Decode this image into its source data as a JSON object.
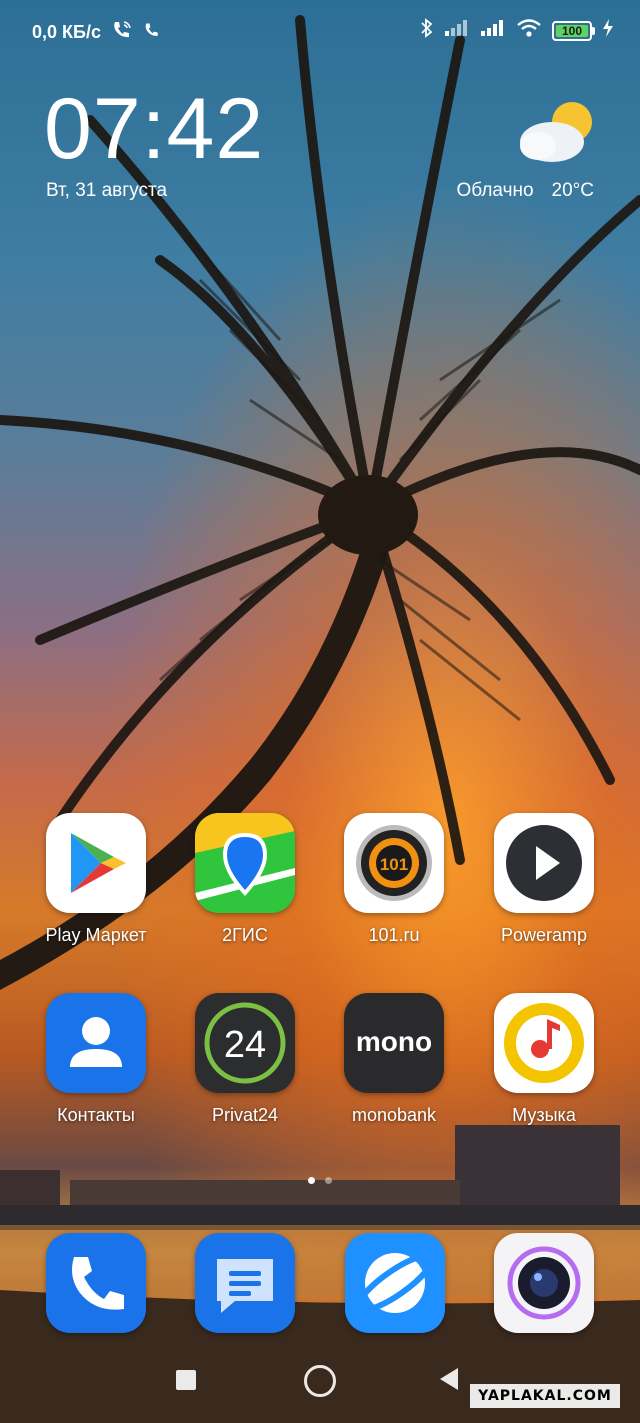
{
  "status_bar": {
    "network_speed": "0,0 КБ/с",
    "battery_level": "100",
    "icons": [
      "wifi-calling-icon",
      "call-icon",
      "bluetooth-icon",
      "signal-icon",
      "signal-icon",
      "wifi-icon",
      "battery-icon",
      "charging-icon"
    ]
  },
  "clock": {
    "time": "07:42",
    "date": "Вт, 31 августа"
  },
  "weather": {
    "condition": "Облачно",
    "temperature": "20°C",
    "icon": "partly-cloudy-icon"
  },
  "apps": [
    {
      "label": "Play Маркет",
      "icon": "play-store-icon"
    },
    {
      "label": "2ГИС",
      "icon": "2gis-icon"
    },
    {
      "label": "101.ru",
      "icon": "101ru-icon"
    },
    {
      "label": "Poweramp",
      "icon": "poweramp-icon"
    },
    {
      "label": "Контакты",
      "icon": "contacts-icon"
    },
    {
      "label": "Privat24",
      "icon": "privat24-icon",
      "badge": "24"
    },
    {
      "label": "monobank",
      "icon": "monobank-icon",
      "badge": "mono"
    },
    {
      "label": "Музыка",
      "icon": "music-icon"
    }
  ],
  "dock": [
    {
      "icon": "phone-icon"
    },
    {
      "icon": "messages-icon"
    },
    {
      "icon": "browser-icon"
    },
    {
      "icon": "camera-icon"
    }
  ],
  "page_indicator": {
    "pages": 2,
    "current": 1
  },
  "navigation": [
    "recents-button",
    "home-button",
    "back-button"
  ],
  "watermark": "YAPLAKAL.COM",
  "colors": {
    "accent_green": "#5fd35f",
    "icon_blue": "#1a73e8",
    "privat_green": "#7bc043",
    "music_yellow": "#f5c400"
  }
}
